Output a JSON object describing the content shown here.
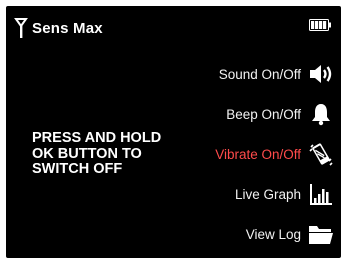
{
  "header": {
    "title": "Sens Max",
    "signal_icon": "antenna-icon",
    "battery_icon": "battery-icon"
  },
  "message": {
    "text": "PRESS AND HOLD OK BUTTON TO SWITCH OFF"
  },
  "menu": {
    "items": [
      {
        "label": "Sound On/Off",
        "icon": "speaker-icon",
        "selected": false
      },
      {
        "label": "Beep On/Off",
        "icon": "bell-icon",
        "selected": false
      },
      {
        "label": "Vibrate On/Off",
        "icon": "vibrate-icon",
        "selected": true
      },
      {
        "label": "Live Graph",
        "icon": "bar-chart-icon",
        "selected": false
      },
      {
        "label": "View Log",
        "icon": "folder-icon",
        "selected": false
      }
    ]
  },
  "colors": {
    "background": "#000000",
    "text": "#ffffff",
    "selected": "#ff4b4b"
  }
}
